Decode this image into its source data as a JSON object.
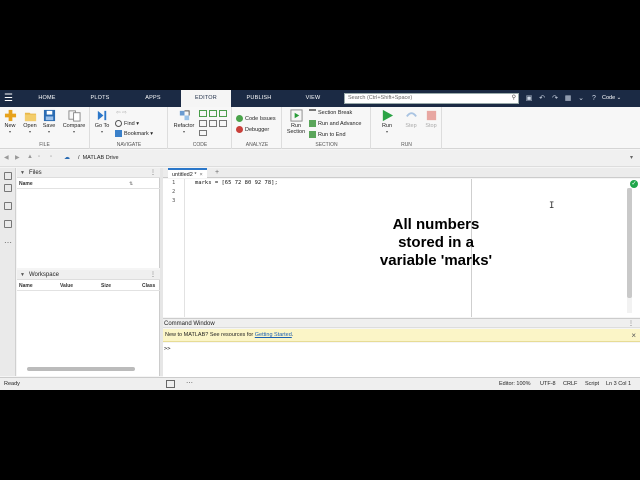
{
  "toolstrip": {
    "tabs": [
      {
        "label": "HOME",
        "active": false
      },
      {
        "label": "PLOTS",
        "active": false
      },
      {
        "label": "APPS",
        "active": false
      },
      {
        "label": "EDITOR",
        "active": true
      },
      {
        "label": "PUBLISH",
        "active": false
      },
      {
        "label": "VIEW",
        "active": false
      }
    ],
    "search_placeholder": "Search (Ctrl+Shift+Space)",
    "code_menu": "Code"
  },
  "ribbon": {
    "file": {
      "label": "FILE",
      "new": "New",
      "open": "Open",
      "save": "Save",
      "compare": "Compare"
    },
    "navigate": {
      "label": "NAVIGATE",
      "go_to": "Go To",
      "find": "Find",
      "bookmark": "Bookmark"
    },
    "code": {
      "label": "CODE",
      "refactor": "Refactor"
    },
    "analyze": {
      "label": "ANALYZE",
      "code_issues": "Code Issues",
      "debugger": "Debugger"
    },
    "section": {
      "label": "SECTION",
      "run_section": "Run Section",
      "section_break": "Section Break",
      "run_and_advance": "Run and Advance",
      "run_to_end": "Run to End"
    },
    "run": {
      "label": "RUN",
      "run": "Run",
      "step": "Step",
      "stop": "Stop"
    }
  },
  "address": {
    "sep": "/",
    "path": "MATLAB Drive"
  },
  "files_panel": {
    "title": "Files",
    "column_name": "Name"
  },
  "workspace_panel": {
    "title": "Workspace",
    "columns": [
      "Name",
      "Value",
      "Size",
      "Class"
    ]
  },
  "editor": {
    "tab_label": "untitled2 *",
    "lines": [
      "1",
      "2",
      "3"
    ],
    "code_line_1": "marks = [65 72 80 92 78];"
  },
  "annotation": {
    "text": "All numbers stored in a variable 'marks'"
  },
  "command_window": {
    "title": "Command Window",
    "notice_text": "New to MATLAB? See resources for ",
    "notice_link": "Getting Started",
    "notice_end": ".",
    "prompt": ">>"
  },
  "status_bar": {
    "ready": "Ready",
    "zoom": "Editor: 100%",
    "encoding": "UTF-8",
    "line_ending": "CRLF",
    "language": "Script",
    "position": "Ln 3 Col 1"
  },
  "colors": {
    "tabbar": "#1b2a44",
    "accent": "#2b77c9",
    "notice": "#fbf5c7",
    "ok": "#1fa64a"
  }
}
